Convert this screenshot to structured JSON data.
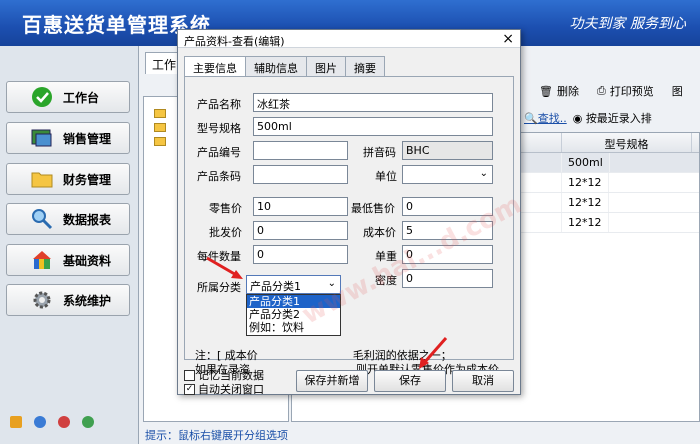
{
  "app": {
    "title": "百惠送货单管理系统",
    "slogan": "功夫到家 服务到心"
  },
  "sidebar": {
    "items": [
      {
        "label": "工作台",
        "icon": "check-circle-icon"
      },
      {
        "label": "销售管理",
        "icon": "window-icon"
      },
      {
        "label": "财务管理",
        "icon": "folder-icon"
      },
      {
        "label": "数据报表",
        "icon": "magnifier-icon"
      },
      {
        "label": "基础资料",
        "icon": "building-blocks-icon"
      },
      {
        "label": "系统维护",
        "icon": "gear-icon"
      }
    ]
  },
  "main": {
    "tab_label": "工作",
    "hint": "提示：鼠标右键展开分组选项",
    "toolbar": {
      "delete": "删除",
      "print_preview": "打印预览",
      "more": "图"
    },
    "search": {
      "find": "查找..",
      "sort_option": "按最近录入排"
    },
    "grid": {
      "columns": [
        "型号规格"
      ],
      "rows": [
        [
          "500ml"
        ],
        [
          "12*12"
        ],
        [
          "12*12"
        ],
        [
          "12*12"
        ]
      ]
    }
  },
  "dialog": {
    "title": "产品资料-查看(编辑)",
    "tabs": [
      "主要信息",
      "辅助信息",
      "图片",
      "摘要"
    ],
    "fields": {
      "product_name": {
        "label": "产品名称",
        "value": "冰红茶"
      },
      "model_spec": {
        "label": "型号规格",
        "value": "500ml"
      },
      "product_code": {
        "label": "产品编号",
        "value": ""
      },
      "pinyin_code": {
        "label": "拼音码",
        "value": "BHC"
      },
      "barcode": {
        "label": "产品条码",
        "value": ""
      },
      "unit": {
        "label": "单位",
        "value": ""
      },
      "retail_price": {
        "label": "零售价",
        "value": "10"
      },
      "min_price": {
        "label": "最低售价",
        "value": "0"
      },
      "wholesale_price": {
        "label": "批发价",
        "value": "0"
      },
      "cost_price": {
        "label": "成本价",
        "value": "5"
      },
      "quantity_per_pack": {
        "label": "每件数量",
        "value": "0"
      },
      "unit_weight": {
        "label": "单重",
        "value": "0"
      },
      "density": {
        "label": "密度",
        "value": "0"
      },
      "category": {
        "label": "所属分类",
        "value": "产品分类1"
      }
    },
    "category_options": [
      "产品分类1",
      "产品分类2",
      "例如：饮料"
    ],
    "note_line1": "注：[ 成本价",
    "note_line1_end": "毛利润的依据之一；",
    "note_line2": "如果在录资",
    "note_line2_end": "，则开单默认零售价作为成本价。",
    "remember_data": {
      "label": "记忆当前数据",
      "checked": false
    },
    "auto_close": {
      "label": "自动关闭窗口",
      "checked": true
    },
    "buttons": {
      "save_new": "保存并新增",
      "save": "保存",
      "cancel": "取消"
    },
    "watermark": "www.hai...d.com"
  },
  "colors": {
    "header_blue": "#1c4fb0",
    "highlight": "#1e63c8",
    "arrow_red": "#e02020"
  }
}
